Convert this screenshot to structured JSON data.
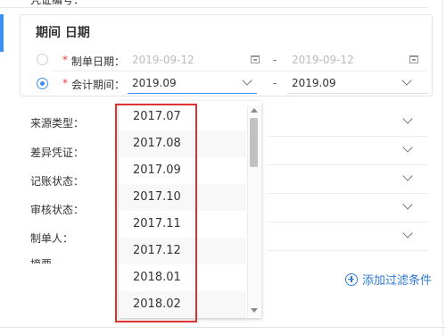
{
  "header": {
    "cut_label": "凭证编号："
  },
  "date_section": {
    "title": "期间 日期",
    "required_mark": "*",
    "make_date": {
      "label": "制单日期：",
      "from": "2019-09-12",
      "dash": "-",
      "to": "2019-09-12",
      "selected": false
    },
    "account_period": {
      "label": "会计期间：",
      "from": "2019.09",
      "dash": "-",
      "to": "2019.09",
      "selected": true
    }
  },
  "filters": [
    {
      "label": "来源类型："
    },
    {
      "label": "差异凭证："
    },
    {
      "label": "记账状态："
    },
    {
      "label": "审核状态："
    },
    {
      "label": "制单人："
    },
    {
      "label": "摘要"
    }
  ],
  "period_dropdown": {
    "options": [
      "2017.07",
      "2017.08",
      "2017.09",
      "2017.10",
      "2017.11",
      "2017.12",
      "2018.01",
      "2018.02"
    ]
  },
  "add_filter": {
    "label": "添加过滤条件"
  }
}
